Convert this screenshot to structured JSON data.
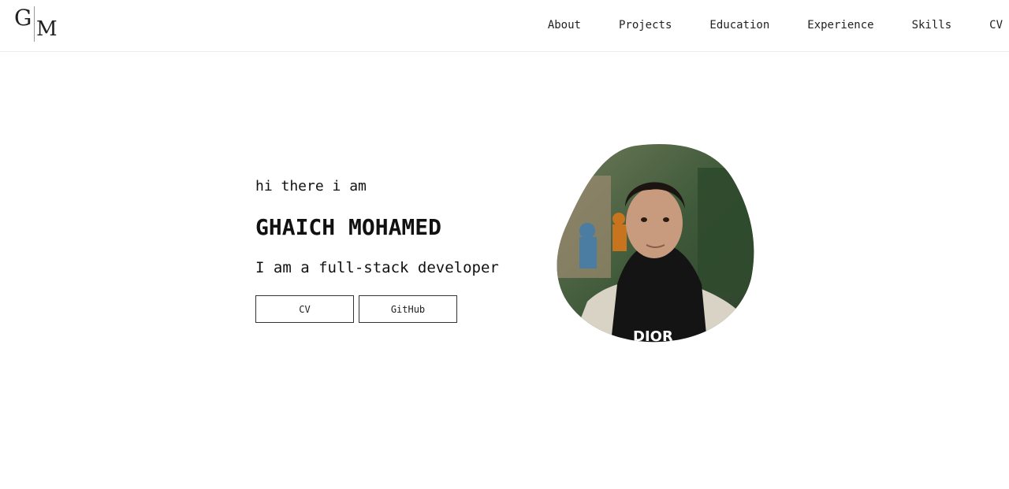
{
  "logo": {
    "first": "G",
    "second": "M"
  },
  "nav": {
    "items": [
      "About",
      "Projects",
      "Education",
      "Experience",
      "Skills",
      "CV"
    ]
  },
  "hero": {
    "greeting": "hi there i am",
    "name": "GHAICH MOHAMED",
    "tagline": "I am a full-stack developer",
    "buttons": {
      "cv": "CV",
      "github": "GitHub"
    }
  }
}
